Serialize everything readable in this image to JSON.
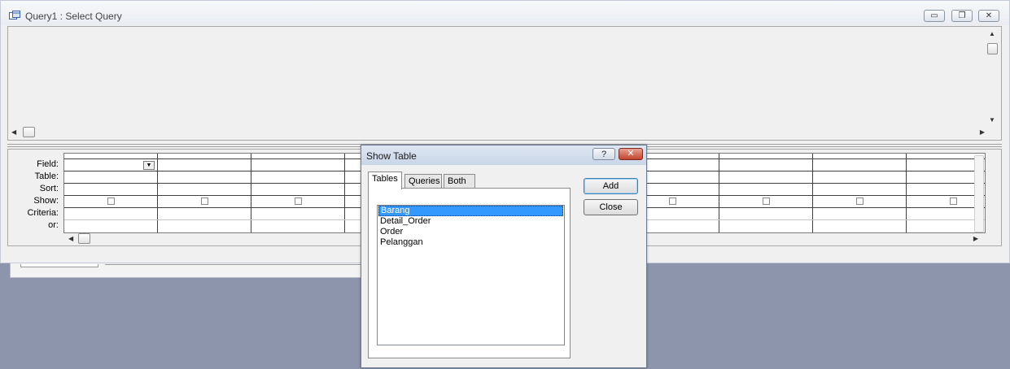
{
  "query_window": {
    "title": "Query1 : Select Query",
    "minimize_symbol": "▭",
    "restore_symbol": "❐",
    "close_symbol": "✕"
  },
  "design_grid": {
    "row_labels": [
      "Field:",
      "Table:",
      "Sort:",
      "Show:",
      "Criteria:",
      "or:"
    ],
    "column_count": 10
  },
  "show_table_dialog": {
    "title": "Show Table",
    "help_symbol": "?",
    "close_symbol": "✕",
    "tabs": [
      {
        "label": "Tables",
        "active": true
      },
      {
        "label": "Queries",
        "active": false
      },
      {
        "label": "Both",
        "active": false
      }
    ],
    "tables": [
      {
        "name": "Barang",
        "selected": true
      },
      {
        "name": "Detail_Order",
        "selected": false
      },
      {
        "name": "Order",
        "selected": false
      },
      {
        "name": "Pelanggan",
        "selected": false
      }
    ],
    "add_label": "Add",
    "close_label": "Close"
  }
}
